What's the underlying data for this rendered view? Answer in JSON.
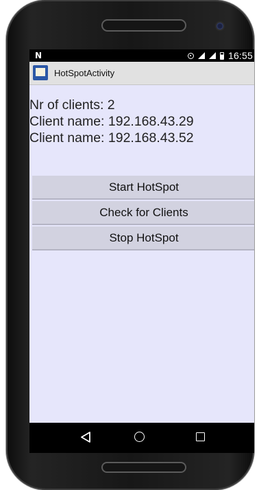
{
  "status_bar": {
    "notification_icon": "N",
    "time": "16:55",
    "icons": [
      "hotspot-icon",
      "signal-icon",
      "signal-icon",
      "battery-icon"
    ]
  },
  "action_bar": {
    "icon": "app-icon",
    "title": "HotSpotActivity"
  },
  "main": {
    "clients_count_text": "Nr of clients: 2",
    "client_names": [
      "Client name: 192.168.43.29",
      "Client name: 192.168.43.52"
    ],
    "buttons": {
      "start": "Start HotSpot",
      "check": "Check for Clients",
      "stop": "Stop HotSpot"
    }
  },
  "nav_bar": {
    "icons": [
      "back-icon",
      "home-icon",
      "recent-apps-icon"
    ]
  },
  "colors": {
    "content_background": "#e6e6fb",
    "button_background": "#d2d2e0",
    "action_bar_background": "#e1e1e1",
    "app_icon_blue": "#2b57a6"
  }
}
